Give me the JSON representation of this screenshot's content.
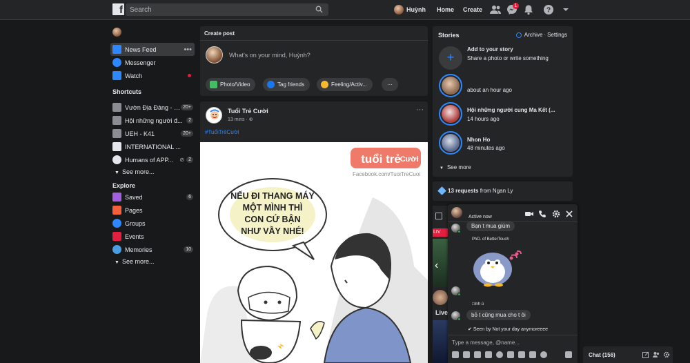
{
  "topbar": {
    "search_placeholder": "Search",
    "profile_name": "Huỳnh",
    "home_label": "Home",
    "create_label": "Create",
    "messenger_badge": "1"
  },
  "left_nav": {
    "main": [
      {
        "label": "News Feed"
      },
      {
        "label": "Messenger"
      },
      {
        "label": "Watch"
      }
    ],
    "shortcuts_title": "Shortcuts",
    "shortcuts": [
      {
        "label": "Vườn Địa Đàng - G...",
        "count": "20+"
      },
      {
        "label": "Hội những người đ...",
        "count": "2"
      },
      {
        "label": "UEH - K41",
        "count": "20+"
      },
      {
        "label": "INTERNATIONAL ...",
        "count": ""
      },
      {
        "label": "Humans of APP...",
        "count": "2"
      }
    ],
    "shortcuts_see_more": "See more...",
    "explore_title": "Explore",
    "explore": [
      {
        "label": "Saved",
        "count": "6"
      },
      {
        "label": "Pages",
        "count": ""
      },
      {
        "label": "Groups",
        "count": ""
      },
      {
        "label": "Events",
        "count": ""
      },
      {
        "label": "Memories",
        "count": "10"
      }
    ],
    "explore_see_more": "See more..."
  },
  "create_post": {
    "title": "Create post",
    "prompt": "What's on your mind, Huỳnh?",
    "buttons": [
      "Photo/Video",
      "Tag friends",
      "Feeling/Activ..."
    ],
    "more": "···"
  },
  "post": {
    "author": "Tuổi Trẻ Cười",
    "time": "13 mins ·",
    "hashtag": "#TuổiTrẻCười",
    "more": "···",
    "comic": {
      "logo": "tuổi trẻ",
      "logo_sub": "Cười",
      "site": "Facebook.com/TuoiTreCuoi",
      "bubble_lines": [
        "NẾU ĐI THANG MÁY",
        "MỘT MÌNH THÌ",
        "CON CỨ BẬN",
        "NHƯ VẦY NHÉ!"
      ]
    }
  },
  "stories": {
    "title": "Stories",
    "archive": "Archive",
    "sep": "·",
    "settings": "Settings",
    "add_title": "Add to your story",
    "add_sub": "Share a photo or write something",
    "items": [
      {
        "name": "",
        "time": "about an hour ago"
      },
      {
        "name": "Hội những người cung Ma Kết (...",
        "time": "14 hours ago"
      },
      {
        "name": "Nhon Ho",
        "time": "48 minutes ago"
      }
    ],
    "see_more": "See more"
  },
  "requests": {
    "count_text": "13 requests",
    "from_text": " from Ngan Ly"
  },
  "side_strip": {
    "live_badge": "LIV",
    "live_label": "Live"
  },
  "chat": {
    "status": "Active now",
    "messages": [
      {
        "text": "Bạn t mua giùm"
      },
      {
        "meta": "PhD. of BetterTouch"
      },
      {
        "meta": "□Inh ú"
      },
      {
        "text": "bỏ t cũng mua cho t ôi"
      }
    ],
    "seen": "Seen by Not your day anymoreeee",
    "input_placeholder": "Type a message, @name..."
  },
  "chatbar": {
    "label": "Chat (156)"
  },
  "colors": {
    "accent": "#2d88ff",
    "background": "#18191a",
    "card": "#242526",
    "badge": "#e41e3f"
  }
}
